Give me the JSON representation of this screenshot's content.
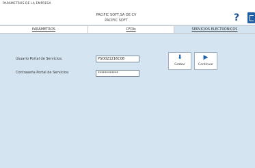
{
  "window": {
    "title": "PARÁMETROS DE LA EMPRESA"
  },
  "company": {
    "name": "PACIFIC SOFT,SA DE CV",
    "short_name": "PACIFIC SOFT"
  },
  "toolbar": {
    "help_glyph": "?"
  },
  "tabs": [
    {
      "label": "PARÁMETROS"
    },
    {
      "label": "CFDIs"
    },
    {
      "label": "SERVICIOS ELECTRÓNICOS"
    }
  ],
  "form": {
    "user_label": "Usuario Portal de Servicios:",
    "user_value": "PSO021216C08",
    "password_label": "Contraseña Portal de Servicios:",
    "password_value": "************"
  },
  "buttons": {
    "save_label": "Grabar",
    "continue_label": "Continuar"
  }
}
